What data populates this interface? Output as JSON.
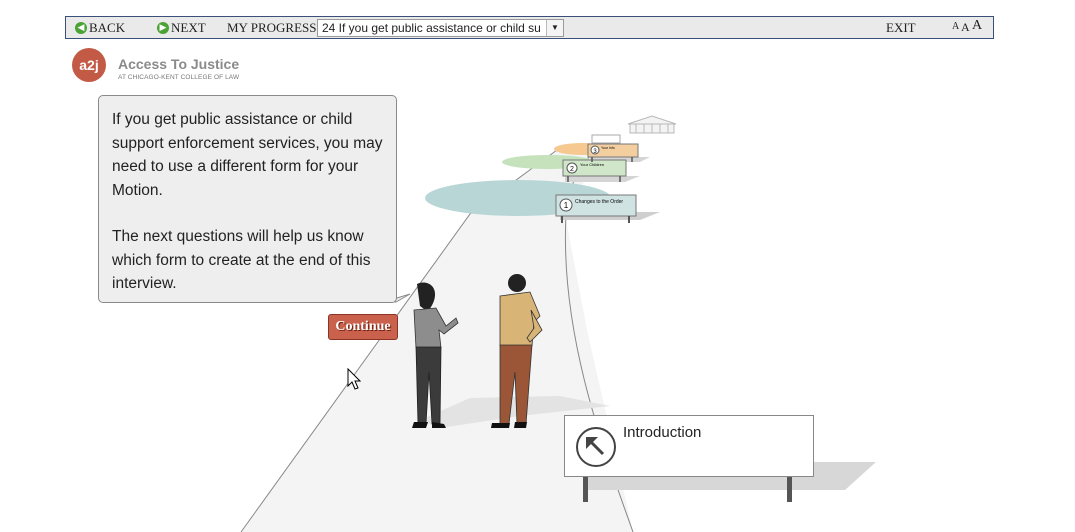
{
  "toolbar": {
    "back_label": "BACK",
    "next_label": "NEXT",
    "progress_label": "MY PROGRESS",
    "progress_value": "24 If you get public assistance or child su",
    "exit_label": "EXIT",
    "font_sizes": [
      "A",
      "A",
      "A"
    ]
  },
  "logo": {
    "badge": "a2j",
    "title": "Access To Justice",
    "subtitle": "AT CHICAGO-KENT COLLEGE OF LAW"
  },
  "question": {
    "paragraph1": "If you get public assistance or child support enforcement services, you may need to use a different form for your Motion.",
    "paragraph2": "The next questions will help us know which form to create at the end of this interview."
  },
  "continue_label": "Continue",
  "signs": {
    "intro": "Introduction",
    "step1_number": "1",
    "step1_label": "Changes to the Order",
    "step2_number": "2",
    "step2_label": "Your Children",
    "step3_number": "3",
    "step3_label": "Your Info"
  },
  "colors": {
    "accent": "#c25a45",
    "continue": "#c9614d",
    "toolbar_border": "#3a4f7a",
    "sign_teal": "#cfe3e3",
    "sign_green": "#cfe6c9",
    "sign_orange": "#f3cf9f"
  }
}
